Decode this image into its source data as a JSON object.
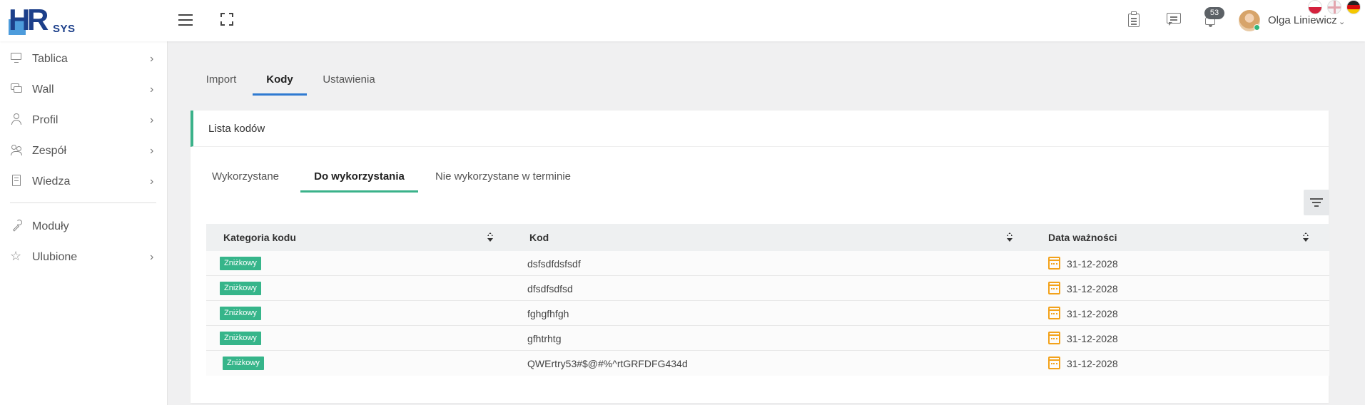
{
  "app": {
    "logo_text": "HRSYS",
    "logo_parts": {
      "h": "H",
      "r": "R",
      "sys": "SYS"
    }
  },
  "topbar": {
    "notifications_count": "53",
    "user_name": "Olga Liniewicz",
    "languages": [
      "pl",
      "en",
      "de"
    ]
  },
  "sidebar": {
    "items": [
      {
        "label": "Tablica",
        "icon": "monitor-icon",
        "has_submenu": true
      },
      {
        "label": "Wall",
        "icon": "wall-icon",
        "has_submenu": true
      },
      {
        "label": "Profil",
        "icon": "user-icon",
        "has_submenu": true
      },
      {
        "label": "Zespół",
        "icon": "team-icon",
        "has_submenu": true
      },
      {
        "label": "Wiedza",
        "icon": "book-icon",
        "has_submenu": true
      },
      {
        "label": "Moduły",
        "icon": "wrench-icon",
        "has_submenu": false
      },
      {
        "label": "Ulubione",
        "icon": "star-icon",
        "has_submenu": true
      }
    ]
  },
  "main_tabs": [
    {
      "label": "Import",
      "active": false
    },
    {
      "label": "Kody",
      "active": true
    },
    {
      "label": "Ustawienia",
      "active": false
    }
  ],
  "card": {
    "title": "Lista kodów",
    "sub_tabs": [
      {
        "label": "Wykorzystane",
        "active": false
      },
      {
        "label": "Do wykorzystania",
        "active": true
      },
      {
        "label": "Nie wykorzystane w terminie",
        "active": false
      }
    ],
    "table": {
      "columns": [
        "Kategoria kodu",
        "Kod",
        "Data ważności"
      ],
      "rows": [
        {
          "category": "Zniżkowy",
          "code": "dsfsdfdsfsdf",
          "date": "31-12-2028"
        },
        {
          "category": "Zniżkowy",
          "code": "dfsdfsdfsd",
          "date": "31-12-2028"
        },
        {
          "category": "Zniżkowy",
          "code": "fghgfhfgh",
          "date": "31-12-2028"
        },
        {
          "category": "Zniżkowy",
          "code": "gfhtrhtg",
          "date": "31-12-2028"
        },
        {
          "category": "Zniżkowy",
          "code": "QWErtry53#$@#%^rtGRFDFG434d",
          "date": "31-12-2028"
        }
      ]
    }
  },
  "colors": {
    "accent_blue": "#2f7ad1",
    "accent_green": "#3bb28a",
    "badge_green": "#36b58a",
    "calendar_orange": "#f3a21a"
  }
}
